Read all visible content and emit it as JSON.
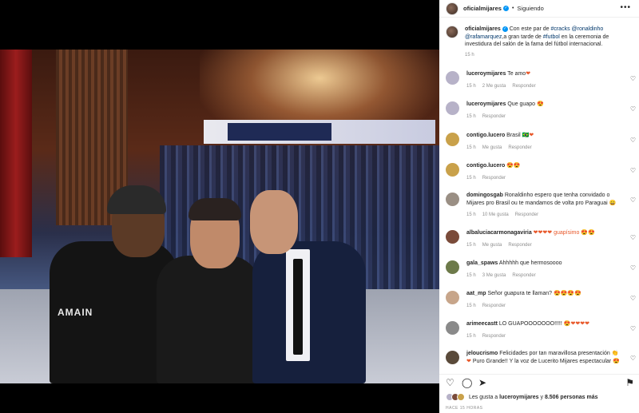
{
  "header": {
    "username": "oficialmijares",
    "separator": "•",
    "follow_status": "Siguiendo",
    "more_icon": "•••"
  },
  "photo": {
    "jacket_logo": "AMAIN"
  },
  "caption": {
    "username": "oficialmijares",
    "text_before": " Con este par de ",
    "hashtag1": "#cracks",
    "mention1": " @ronaldinho",
    "mention2": "@rafamarquez",
    "text_mid": ",a gran tarde de ",
    "hashtag2": "#futbol",
    "text_after": " en la ceremonia de investidura del salón de la fama del fútbol internacional.",
    "time": "15 h"
  },
  "comments": [
    {
      "username": "luceroymijares",
      "text": " Te amo",
      "emoji": "❤",
      "time": "15 h",
      "likes": "2 Me gusta",
      "reply": "Responder",
      "avatar_color": "#b7b2c8"
    },
    {
      "username": "luceroymijares",
      "text": " Que guapo ",
      "emoji": "😍",
      "time": "15 h",
      "likes": "",
      "reply": "Responder",
      "avatar_color": "#b7b2c8"
    },
    {
      "username": "contigo.lucero",
      "text": " Brasil ",
      "emoji": "🇧🇷❤",
      "time": "15 h",
      "likes": "Me gusta",
      "reply": "Responder",
      "avatar_color": "#c9a14a"
    },
    {
      "username": "contigo.lucero",
      "text": " ",
      "emoji": "😍😍",
      "time": "15 h",
      "likes": "",
      "reply": "Responder",
      "avatar_color": "#c9a14a"
    },
    {
      "username": "domingosgab",
      "text": " Ronaldinho espero que tenha convidado o Mijares pro Brasil ou te mandamos de volta pro Paraguai ",
      "emoji": "😄",
      "time": "15 h",
      "likes": "10 Me gusta",
      "reply": "Responder",
      "avatar_color": "#9a8f84"
    },
    {
      "username": "albaluciacarmonagaviria",
      "text": " ",
      "emoji": "❤❤❤❤ guapísimo 😍😍",
      "time": "15 h",
      "likes": "Me gusta",
      "reply": "Responder",
      "avatar_color": "#7a4b3a"
    },
    {
      "username": "gala_spaws",
      "text": " Ahhhhh que hermosoooo",
      "emoji": "",
      "time": "15 h",
      "likes": "3 Me gusta",
      "reply": "Responder",
      "avatar_color": "#6d7a4a"
    },
    {
      "username": "aat_mp",
      "text": " Señor guapura te llaman? ",
      "emoji": "😍😍😍😍",
      "time": "15 h",
      "likes": "",
      "reply": "Responder",
      "avatar_color": "#c7a58a"
    },
    {
      "username": "arimeecastt",
      "text": " LO GUAPOOOOOOO!!!!! ",
      "emoji": "😍❤❤❤❤",
      "time": "15 h",
      "likes": "",
      "reply": "Responder",
      "avatar_color": "#8a8a8a"
    },
    {
      "username": "jeloucrismo",
      "text": " Felicidades por tan maravillosa presentación 👏 ",
      "emoji": "❤",
      "text2": " Puro Grande!! Y la voz de Lucerito Mijares espectacular ",
      "emoji2": "😍",
      "time": "",
      "likes": "",
      "reply": "",
      "avatar_color": "#5a4a3a"
    }
  ],
  "actions": {
    "heart_icon": "♡",
    "comment_icon": "◯",
    "share_icon": "➤",
    "save_icon": "⚑"
  },
  "likes": {
    "prefix": "Les gusta a ",
    "user": "luceroymijares",
    "middle": " y ",
    "count": "8.506 personas más"
  },
  "time_ago": "HACE 15 HORAS"
}
